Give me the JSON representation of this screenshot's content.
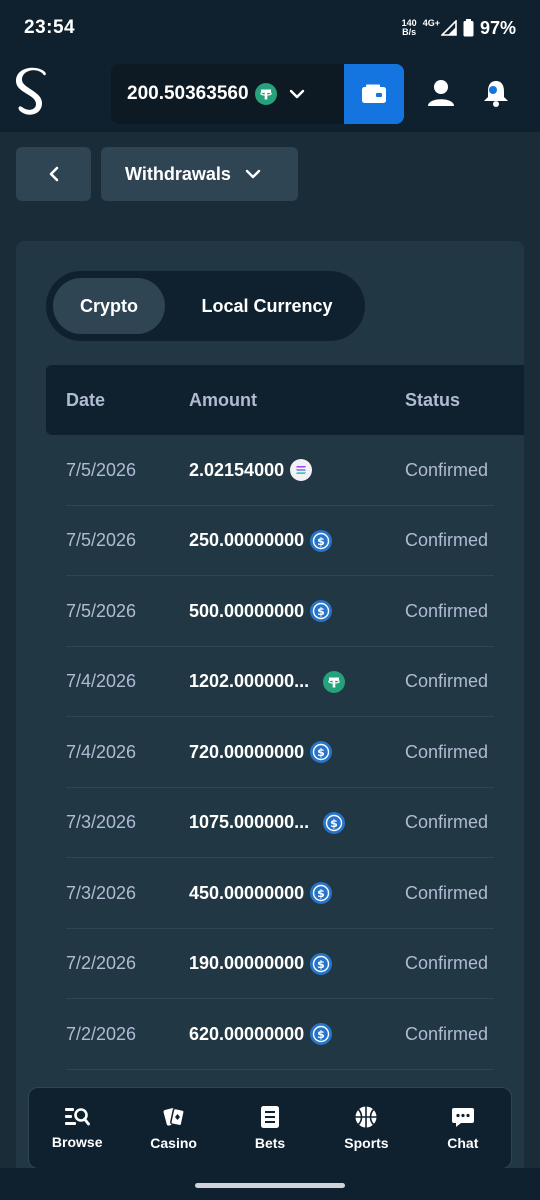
{
  "status_bar": {
    "time": "23:54",
    "net_speed_value": "140",
    "net_speed_unit": "B/s",
    "network": "4G+",
    "battery": "97%"
  },
  "header": {
    "balance": "200.50363560",
    "balance_currency_icon": "tether-icon",
    "brand_color": "#1475e1"
  },
  "nav": {
    "section_label": "Withdrawals"
  },
  "tabs": [
    {
      "label": "Crypto",
      "active": true
    },
    {
      "label": "Local Currency",
      "active": false
    }
  ],
  "table": {
    "headers": [
      "Date",
      "Amount",
      "Status"
    ],
    "rows": [
      {
        "date": "7/5/2026",
        "amount": "2.02154000",
        "coin": "solana-icon",
        "status": "Confirmed"
      },
      {
        "date": "7/5/2026",
        "amount": "250.00000000",
        "coin": "usdc-icon",
        "status": "Confirmed"
      },
      {
        "date": "7/5/2026",
        "amount": "500.00000000",
        "coin": "usdc-icon",
        "status": "Confirmed"
      },
      {
        "date": "7/4/2026",
        "amount": "1202.000000...",
        "coin": "tether-icon",
        "status": "Confirmed"
      },
      {
        "date": "7/4/2026",
        "amount": "720.00000000",
        "coin": "usdc-icon",
        "status": "Confirmed"
      },
      {
        "date": "7/3/2026",
        "amount": "1075.000000...",
        "coin": "usdc-icon",
        "status": "Confirmed"
      },
      {
        "date": "7/3/2026",
        "amount": "450.00000000",
        "coin": "usdc-icon",
        "status": "Confirmed"
      },
      {
        "date": "7/2/2026",
        "amount": "190.00000000",
        "coin": "usdc-icon",
        "status": "Confirmed"
      },
      {
        "date": "7/2/2026",
        "amount": "620.00000000",
        "coin": "usdc-icon",
        "status": "Confirmed"
      }
    ]
  },
  "bottom_nav": [
    {
      "label": "Browse",
      "icon": "browse-icon"
    },
    {
      "label": "Casino",
      "icon": "cards-icon"
    },
    {
      "label": "Bets",
      "icon": "bets-icon"
    },
    {
      "label": "Sports",
      "icon": "basketball-icon"
    },
    {
      "label": "Chat",
      "icon": "chat-icon"
    }
  ]
}
